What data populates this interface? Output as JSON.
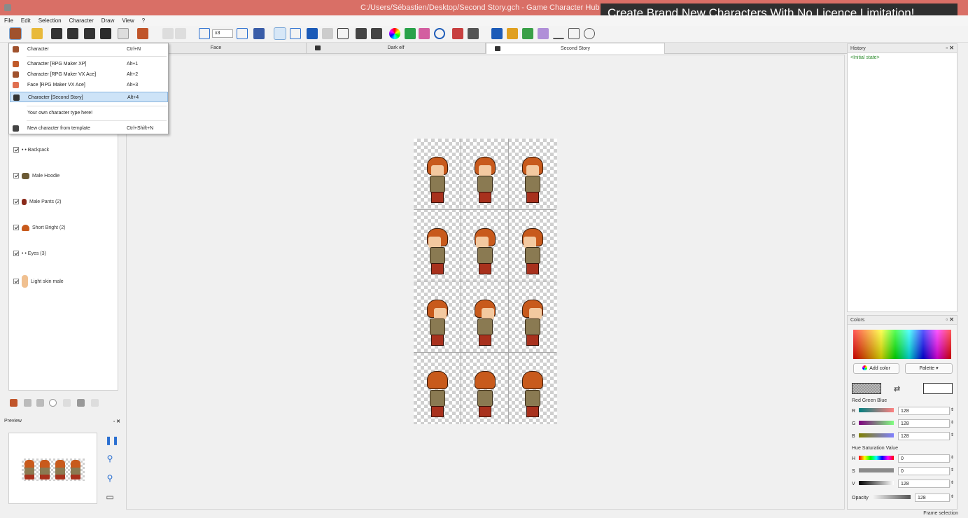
{
  "window": {
    "path_title": "C:/Users/Sébastien/Desktop/Second Story.gch - Game Character Hub",
    "banner": "Create Brand New Characters With No Licence Limitation!"
  },
  "menubar": [
    "File",
    "Edit",
    "Selection",
    "Character",
    "Draw",
    "View",
    "?"
  ],
  "toolbar": {
    "zoom_value": "x3"
  },
  "tabs": [
    {
      "label": "Face",
      "active": false
    },
    {
      "label": "Dark elf",
      "active": false
    },
    {
      "label": "Second Story",
      "active": true
    }
  ],
  "new_menu": {
    "items": [
      {
        "label": "Character",
        "shortcut": "Ctrl+N",
        "icon": "character-icon"
      },
      {
        "label": "Character [RPG Maker XP]",
        "shortcut": "Alt+1",
        "icon": "rpgmaker-xp-icon"
      },
      {
        "label": "Character [RPG Maker VX Ace]",
        "shortcut": "Alt+2",
        "icon": "rpgmaker-vxace-icon"
      },
      {
        "label": "Face [RPG Maker VX Ace]",
        "shortcut": "Alt+3",
        "icon": "face-icon"
      },
      {
        "label": "Character [Second Story]",
        "shortcut": "Alt+4",
        "icon": "second-story-icon",
        "highlighted": true
      },
      {
        "label": "Your own character type here!",
        "shortcut": ""
      },
      {
        "label": "New character from template",
        "shortcut": "Ctrl+Shift+N",
        "icon": "template-icon"
      }
    ]
  },
  "layers": [
    {
      "label": "• • Backpack",
      "checked": true
    },
    {
      "label": "Male Hoodie",
      "checked": true
    },
    {
      "label": "Male Pants (2)",
      "checked": true
    },
    {
      "label": "Short Bright (2)",
      "checked": true
    },
    {
      "label": "• • Eyes (3)",
      "checked": true
    },
    {
      "label": "Light skin male",
      "checked": true
    }
  ],
  "preview": {
    "title": "Preview",
    "controls": [
      "pause-icon",
      "zoom-in-icon",
      "zoom-out-icon",
      "book-icon"
    ]
  },
  "history": {
    "title": "History",
    "entries": [
      "<Initial state>"
    ]
  },
  "colors": {
    "title": "Colors",
    "add_color": "Add color",
    "palette": "Palette",
    "rgb_group": "Red Green Blue",
    "hsv_group": "Hue Saturation Value",
    "r_label": "R",
    "r_value": "128",
    "g_label": "G",
    "g_value": "128",
    "b_label": "B",
    "b_value": "128",
    "h_label": "H",
    "h_value": "0",
    "s_label": "S",
    "s_value": "0",
    "v_label": "V",
    "v_value": "128",
    "opacity_label": "Opacity",
    "opacity_value": "128",
    "accent": "#2a6fd1"
  },
  "status": "Frame selection"
}
